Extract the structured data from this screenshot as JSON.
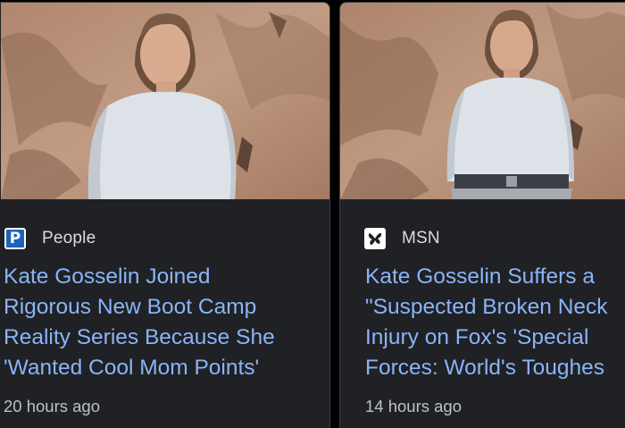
{
  "cards": [
    {
      "source": "People",
      "source_logo": "people-logo-icon",
      "headline_lines": [
        "Kate Gosselin Joined",
        "Rigorous New Boot Camp",
        "Reality Series Because She",
        "'Wanted Cool Mom Points'"
      ],
      "timestamp": "20 hours ago",
      "logo_letter": "P"
    },
    {
      "source": "MSN",
      "source_logo": "msn-butterfly-icon",
      "headline_lines": [
        "Kate Gosselin Suffers a",
        "\"Suspected Broken Neck",
        "Injury on Fox's 'Special",
        "Forces: World's Toughes"
      ],
      "timestamp": "14 hours ago"
    }
  ],
  "colors": {
    "card_bg": "#202124",
    "headline": "#8ab4f8",
    "meta_text": "#bdc1c6",
    "people_brand": "#1f63b8"
  }
}
